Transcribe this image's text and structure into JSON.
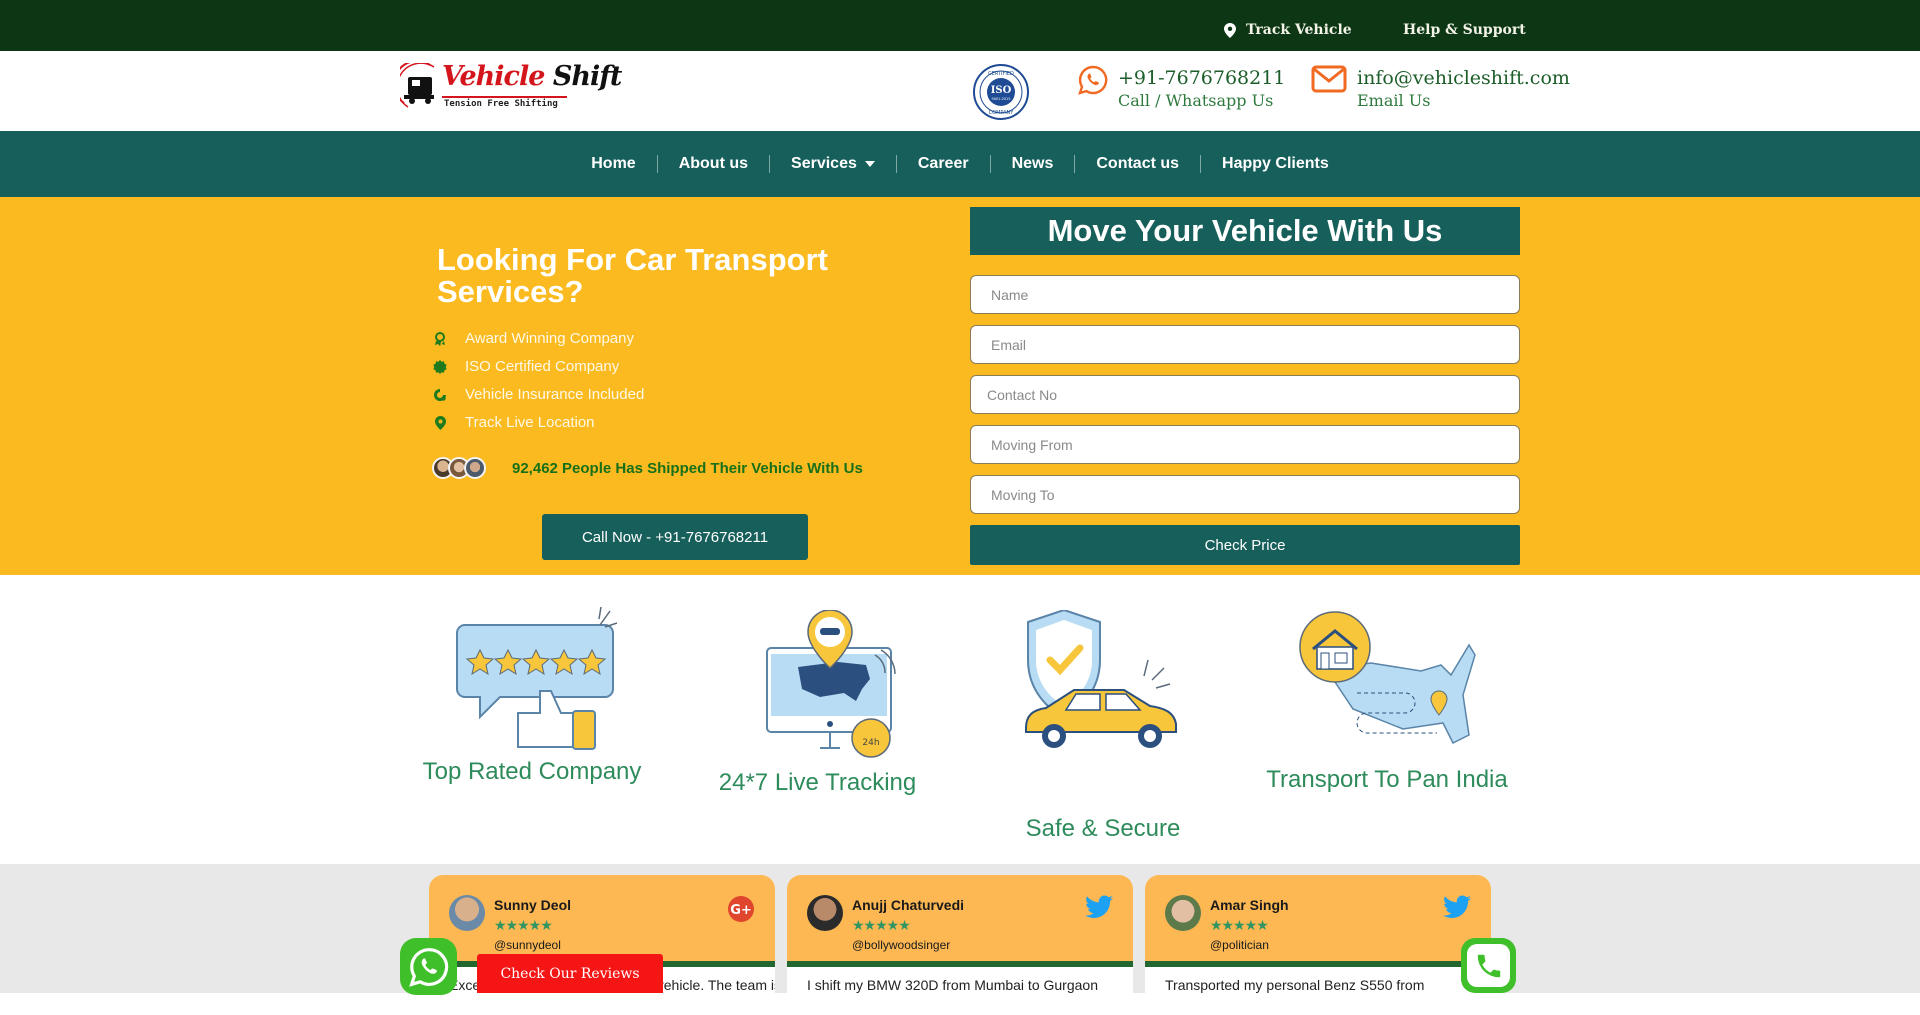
{
  "topbar": {
    "track_label": "Track Vehicle",
    "help_label": "Help & Support"
  },
  "header": {
    "logo": {
      "brand_part1": "Vehicle",
      "brand_part2": "Shift",
      "tagline": "Tension Free Shifting"
    },
    "iso_badge": {
      "top": "CERTIFIED",
      "middle": "ISO",
      "code": "9001:2015",
      "bottom": "COMPANY"
    },
    "phone": {
      "number": "+91-7676768211",
      "label": "Call / Whatsapp Us"
    },
    "email": {
      "address": "info@vehicleshift.com",
      "label": "Email Us"
    }
  },
  "nav": {
    "items": [
      {
        "label": "Home"
      },
      {
        "label": "About us"
      },
      {
        "label": "Services",
        "has_dropdown": true
      },
      {
        "label": "Career"
      },
      {
        "label": "News"
      },
      {
        "label": "Contact us"
      },
      {
        "label": "Happy Clients"
      }
    ]
  },
  "hero": {
    "title": "Looking For Car Transport Services?",
    "features": [
      {
        "icon": "award-icon",
        "label": "Award Winning Company"
      },
      {
        "icon": "certificate-icon",
        "label": "ISO Certified Company"
      },
      {
        "icon": "insurance-icon",
        "label": "Vehicle Insurance Included"
      },
      {
        "icon": "location-pin-icon",
        "label": "Track Live Location"
      }
    ],
    "shipped_text": "92,462 People Has Shipped Their Vehicle With Us",
    "call_button": "Call Now - +91-7676768211",
    "form": {
      "title": "Move Your Vehicle With Us",
      "fields": [
        {
          "placeholder": "Name",
          "value": ""
        },
        {
          "placeholder": "Email",
          "value": ""
        },
        {
          "placeholder": "Contact No",
          "value": ""
        },
        {
          "placeholder": "Moving From",
          "value": ""
        },
        {
          "placeholder": "Moving To",
          "value": ""
        }
      ],
      "submit_label": "Check Price"
    }
  },
  "features": [
    {
      "label": "Top Rated Company",
      "rating_stars": 5
    },
    {
      "label": "24*7 Live Tracking",
      "badge": "24h"
    },
    {
      "label": "Safe & Secure"
    },
    {
      "label": "Transport To Pan India"
    }
  ],
  "reviews": [
    {
      "name": "Sunny Deol",
      "handle": "@sunnydeol",
      "rating": 5,
      "source": "google-plus",
      "text": "Excellent service for shipping my vehicle. The team is"
    },
    {
      "name": "Anujj Chaturvedi",
      "handle": "@bollywoodsinger",
      "rating": 5,
      "source": "twitter",
      "text": "I shift my BMW 320D from Mumbai to Gurgaon"
    },
    {
      "name": "Amar Singh",
      "handle": "@politician",
      "rating": 5,
      "source": "twitter",
      "text": "Transported my personal Benz S550 from"
    }
  ],
  "floating": {
    "check_reviews_label": "Check Our Reviews"
  },
  "colors": {
    "topbar": "#0d3714",
    "nav": "#175f5a",
    "hero": "#fbba20",
    "accent_green": "#2e8b5b",
    "review_header": "#fdb853",
    "cta_red": "#f51515",
    "whatsapp": "#3fbf29"
  }
}
